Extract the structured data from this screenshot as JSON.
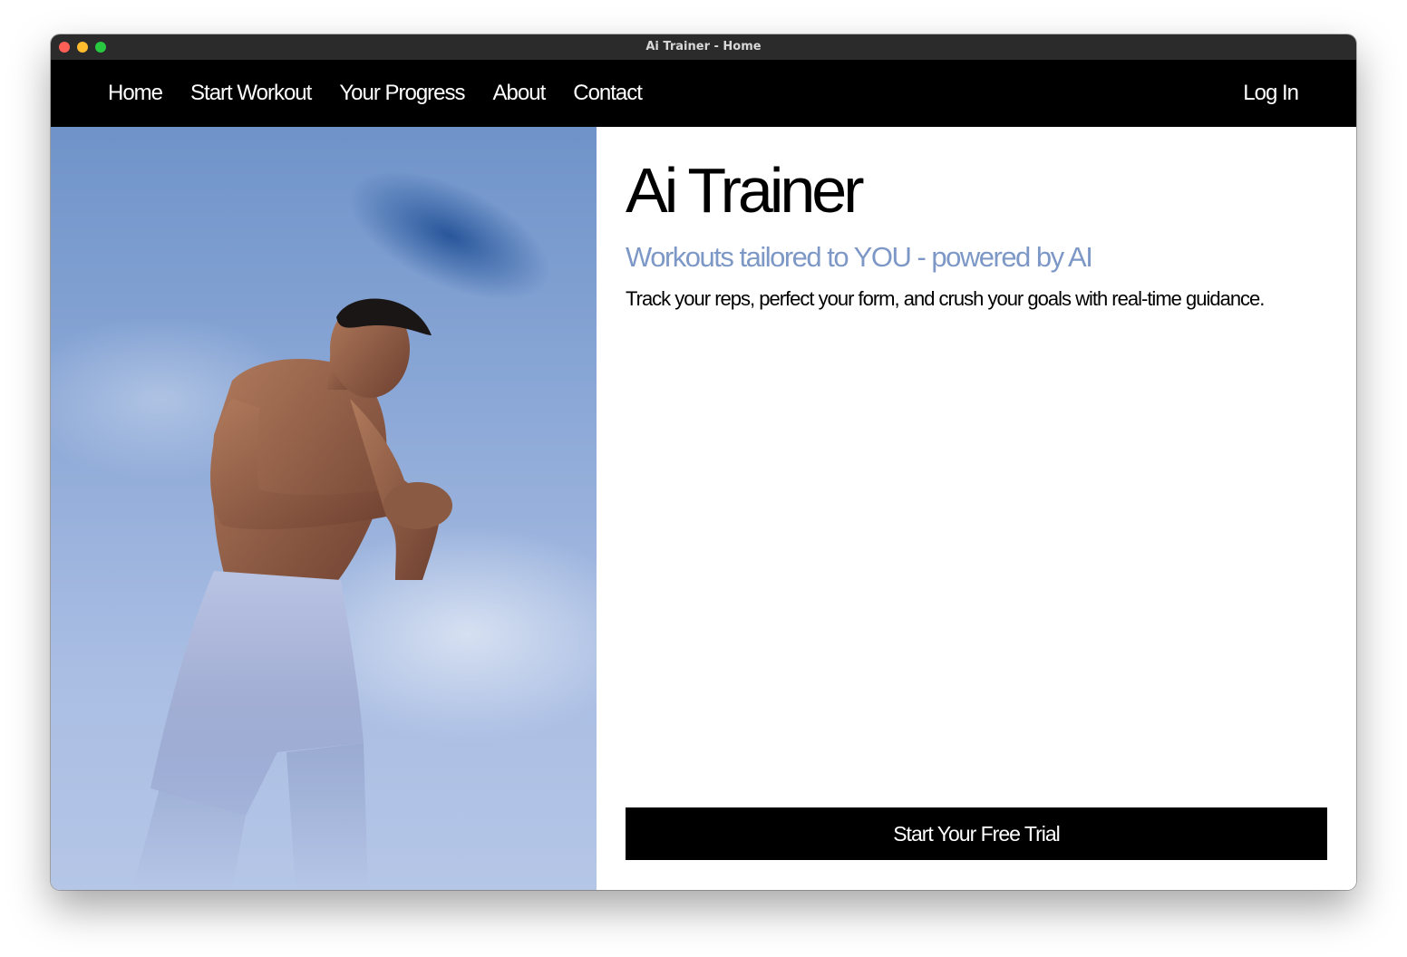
{
  "window": {
    "title": "Ai Trainer - Home"
  },
  "nav": {
    "links": [
      "Home",
      "Start Workout",
      "Your Progress",
      "About",
      "Contact"
    ],
    "login": "Log In"
  },
  "hero": {
    "title": "Ai Trainer",
    "subtitle": "Workouts tailored to YOU - powered by AI",
    "description": "Track your reps, perfect your form, and crush your goals with real-time guidance.",
    "cta": "Start Your Free Trial"
  },
  "colors": {
    "nav_background": "#000000",
    "accent_subtitle": "#7d98c6",
    "cta_background": "#000000",
    "image_sky": "#8aa7d6"
  }
}
